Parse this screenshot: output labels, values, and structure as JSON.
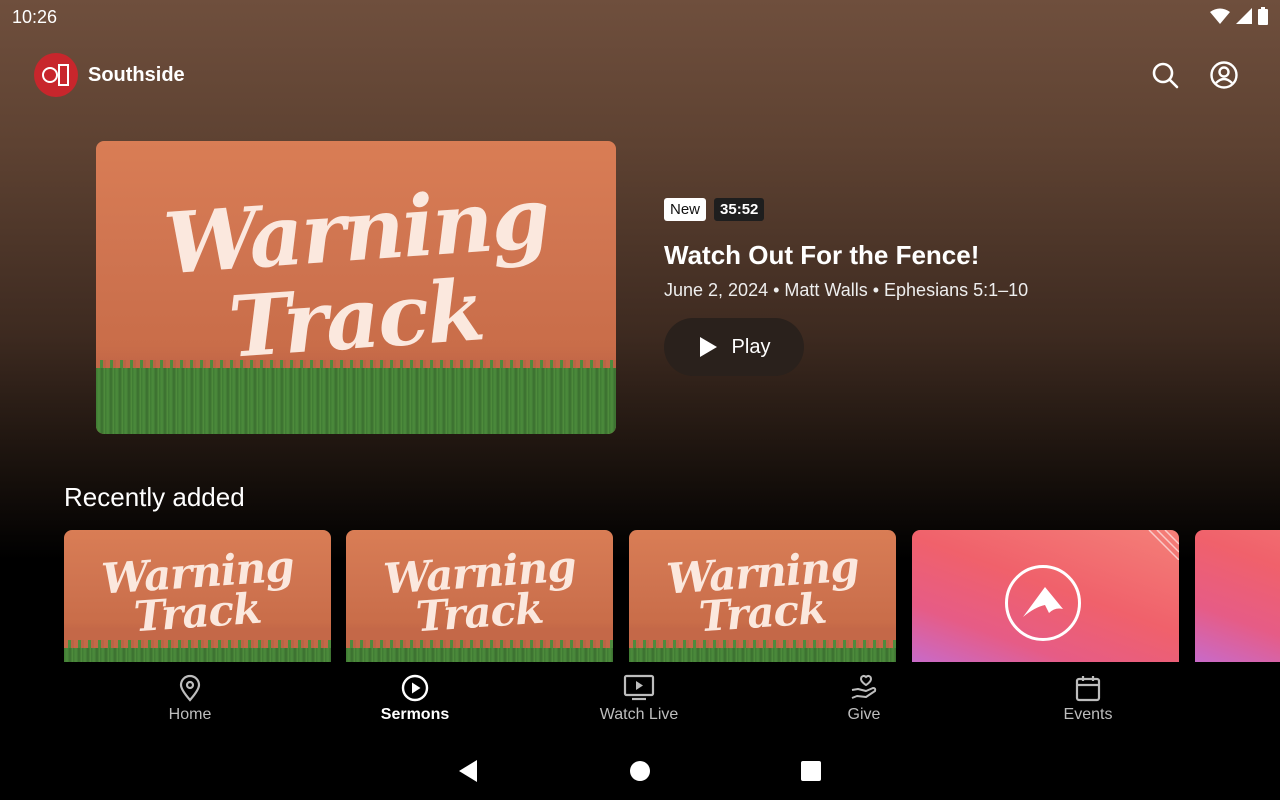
{
  "status": {
    "time": "10:26"
  },
  "app": {
    "name": "Southside"
  },
  "hero": {
    "badge_new": "New",
    "duration": "35:52",
    "title": "Watch Out For the Fence!",
    "meta": "June 2, 2024 • Matt Walls • Ephesians 5:1–10",
    "play_label": "Play",
    "art_line1": "Warning",
    "art_line2": "Track"
  },
  "recent": {
    "title": "Recently added",
    "cards": [
      {
        "line1": "Warning",
        "line2": "Track"
      },
      {
        "line1": "Warning",
        "line2": "Track"
      },
      {
        "line1": "Warning",
        "line2": "Track"
      }
    ]
  },
  "nav": {
    "items": [
      {
        "label": "Home",
        "icon": "location-pin-icon"
      },
      {
        "label": "Sermons",
        "icon": "play-circle-icon",
        "active": true
      },
      {
        "label": "Watch Live",
        "icon": "tv-play-icon"
      },
      {
        "label": "Give",
        "icon": "hand-heart-icon"
      },
      {
        "label": "Events",
        "icon": "calendar-icon"
      }
    ]
  },
  "colors": {
    "accent": "#c8262c",
    "background": "#000000"
  }
}
